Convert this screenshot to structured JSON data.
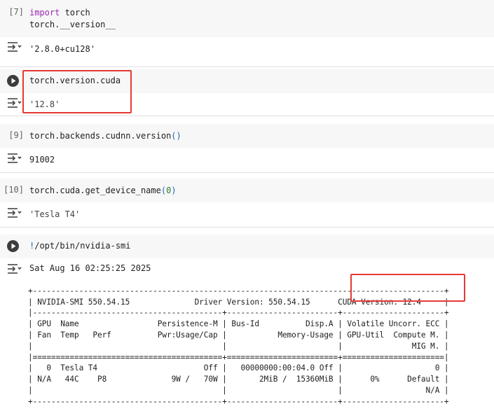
{
  "cells": [
    {
      "id": "c7",
      "exec_label": "[7]",
      "code_lines": [
        [
          "import",
          " torch"
        ],
        [
          "torch.__version__"
        ]
      ],
      "output": "'2.8.0+cu128'"
    },
    {
      "id": "c8",
      "exec_label": "",
      "code": "torch.version.cuda",
      "output": "'12.8'"
    },
    {
      "id": "c9",
      "exec_label": "[9]",
      "code_prefix": "torch.backends.cudnn.version",
      "code_suffix": "()",
      "output": "91002"
    },
    {
      "id": "c10",
      "exec_label": "[10]",
      "code_prefix": "torch.cuda.get_device_name",
      "code_paren_open": "(",
      "code_arg": "0",
      "code_paren_close": ")",
      "output": "'Tesla T4'"
    },
    {
      "id": "c11",
      "exec_label": "",
      "code_bang": "!",
      "code": "/opt/bin/nvidia-smi",
      "output_date": "Sat Aug 16 02:25:25 2025"
    }
  ],
  "nvidia_smi": {
    "lines": [
      "+-----------------------------------------------------------------------------------------+",
      "| NVIDIA-SMI 550.54.15              Driver Version: 550.54.15      CUDA Version: 12.4     |",
      "|-----------------------------------------+------------------------+----------------------+",
      "| GPU  Name                 Persistence-M | Bus-Id          Disp.A | Volatile Uncorr. ECC |",
      "| Fan  Temp   Perf          Pwr:Usage/Cap |           Memory-Usage | GPU-Util  Compute M. |",
      "|                                         |                        |               MIG M. |",
      "|=========================================+========================+======================|",
      "|   0  Tesla T4                       Off |   00000000:00:04.0 Off |                    0 |",
      "| N/A   44C    P8              9W /   70W |       2MiB /  15360MiB |      0%      Default |",
      "|                                         |                        |                  N/A |",
      "+-----------------------------------------+------------------------+----------------------+"
    ]
  },
  "colors": {
    "keyword": "#9c27b0",
    "highlight": "#e53935",
    "code_bg": "#f7f7f7"
  },
  "icons": {
    "output": "output-toggle-icon",
    "run": "run-cell-icon"
  }
}
